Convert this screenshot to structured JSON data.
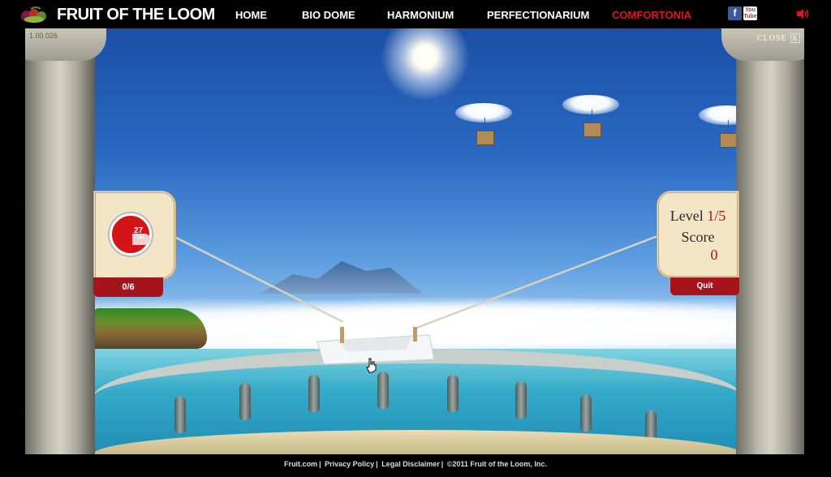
{
  "brand": {
    "logo_text": "FRUIT OF THE LOOM"
  },
  "nav": {
    "items": [
      {
        "label": "HOME",
        "active": false
      },
      {
        "label": "BIO DOME",
        "active": false
      },
      {
        "label": "HARMONIUM",
        "active": false
      },
      {
        "label": "PERFECTIONARIUM",
        "active": false
      },
      {
        "label": "COMFORTONIA",
        "active": true
      }
    ],
    "active_color": "#e2141f"
  },
  "social": {
    "facebook_icon": "facebook-icon",
    "youtube_icon": "youtube-icon",
    "sound_icon": "speaker-icon"
  },
  "game": {
    "version": "1.00.026",
    "close_label": "CLOSE",
    "close_x": "X",
    "timer_value": "27",
    "timer_unit": "sec",
    "caught_count": "0/6",
    "level_label": "Level",
    "level_value": "1/5",
    "score_label": "Score",
    "score_value": "0",
    "quit_label": "Quit"
  },
  "footer": {
    "links": [
      "Fruit.com",
      "Privacy Policy",
      "Legal Disclaimer"
    ],
    "copyright": "©2011 Fruit of the Loom, Inc."
  }
}
